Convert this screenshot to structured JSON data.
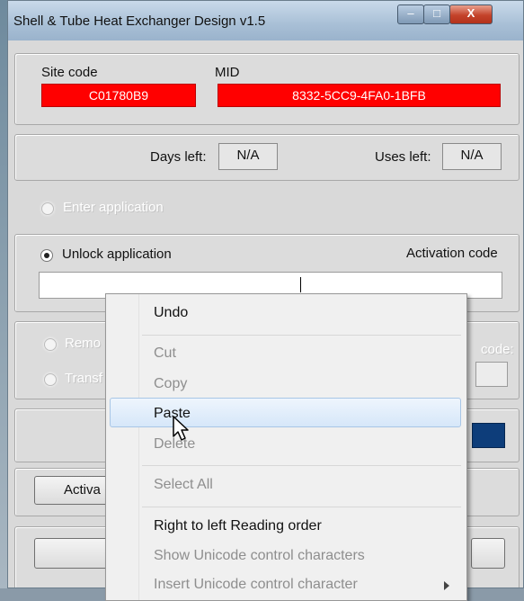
{
  "window": {
    "title": "Shell & Tube Heat Exchanger Design v1.5",
    "minimize_glyph": "–",
    "maximize_glyph": "□",
    "close_glyph": "X"
  },
  "ids": {
    "site_code_label": "Site code",
    "site_code_value": "C01780B9",
    "mid_label": "MID",
    "mid_value": "8332-5CC9-4FA0-1BFB"
  },
  "limits": {
    "days_left_label": "Days left:",
    "days_left_value": "N/A",
    "uses_left_label": "Uses left:",
    "uses_left_value": "N/A"
  },
  "options": {
    "enter_application": "Enter application",
    "unlock_application": "Unlock application",
    "activation_code_label": "Activation code",
    "activation_code_value": "",
    "remove_partial": "Remo",
    "transfer_partial": "Transf",
    "code_partial": "code:",
    "activate_partial": "Activa"
  },
  "context_menu": {
    "items": [
      {
        "label": "Undo",
        "enabled": true
      },
      {
        "label": "Cut",
        "enabled": false
      },
      {
        "label": "Copy",
        "enabled": false
      },
      {
        "label": "Paste",
        "enabled": true,
        "highlighted": true
      },
      {
        "label": "Delete",
        "enabled": false
      },
      {
        "label": "Select All",
        "enabled": false
      },
      {
        "label": "Right to left Reading order",
        "enabled": true
      },
      {
        "label": "Show Unicode control characters",
        "enabled": false
      },
      {
        "label": "Insert Unicode control character",
        "enabled": false,
        "has_submenu": true
      }
    ]
  },
  "colors": {
    "red_field": "#ff0000",
    "highlight": "#d6e7f9",
    "navy": "#0d3d7a"
  }
}
